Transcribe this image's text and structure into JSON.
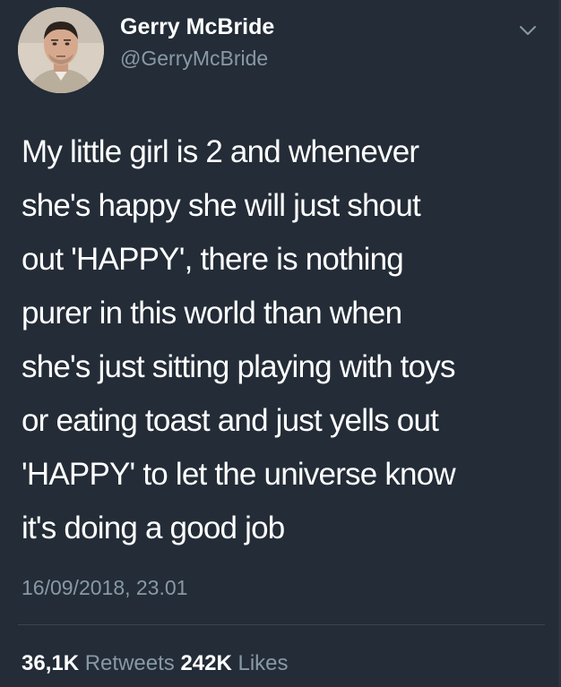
{
  "author": {
    "name": "Gerry McBride",
    "handle": "@GerryMcBride",
    "avatar_icon": "user-avatar"
  },
  "menu_icon": "chevron-down-icon",
  "tweet": {
    "lines": [
      "My little girl is 2 and whenever",
      "she's happy she will just shout",
      "out 'HAPPY', there is nothing",
      "purer in this world than when",
      "she's just sitting playing with toys",
      "or eating toast and just yells out",
      "'HAPPY' to let the universe know",
      "it's doing a good job"
    ],
    "timestamp": "16/09/2018, 23.01"
  },
  "stats": {
    "retweets_count": "36,1K",
    "retweets_label": "Retweets",
    "likes_count": "242K",
    "likes_label": "Likes"
  },
  "colors": {
    "background": "#232c37",
    "text": "#ffffff",
    "secondary_text": "#8899a6",
    "divider": "#3a4553"
  }
}
